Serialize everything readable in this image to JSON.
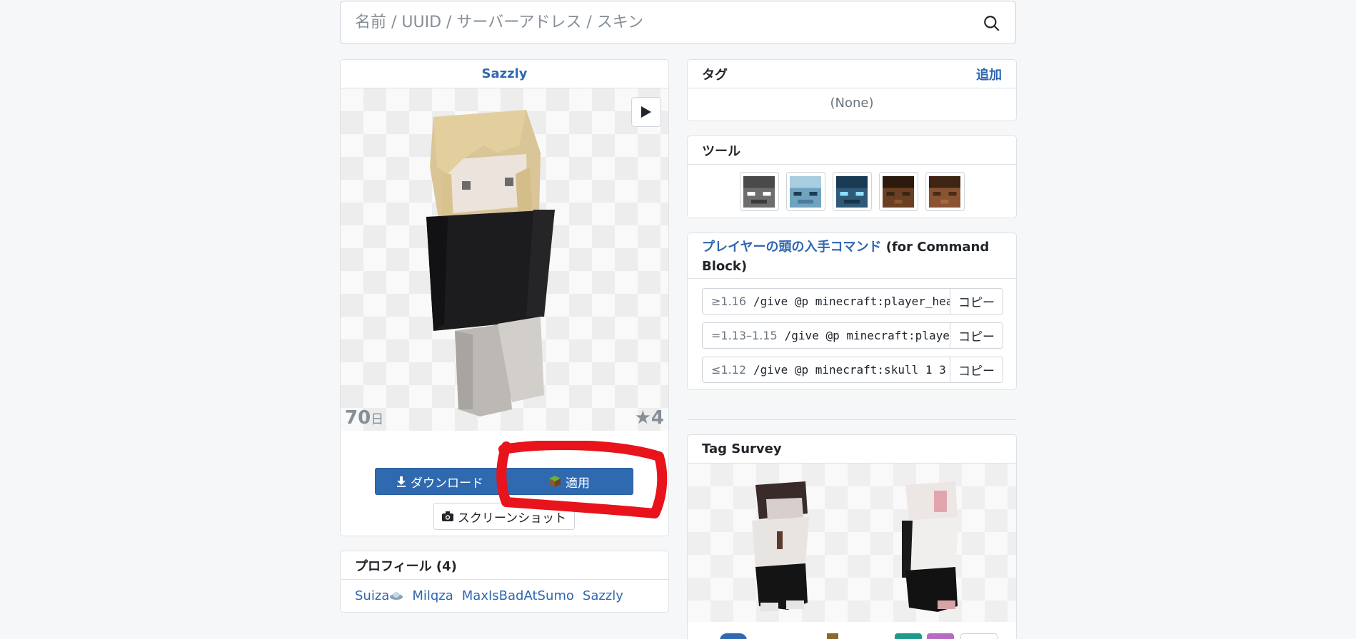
{
  "search": {
    "placeholder": "名前 / UUID / サーバーアドレス / スキン"
  },
  "skin": {
    "name": "Sazzly",
    "days_value": "70",
    "days_unit": "日",
    "stars": "★4",
    "download_label": "ダウンロード",
    "apply_label": "適用",
    "screenshot_label": "スクリーンショット"
  },
  "profile": {
    "title": "プロフィール (4)",
    "names": [
      "Suiza",
      "Milqza",
      "MaxIsBadAtSumo",
      "Sazzly"
    ]
  },
  "tags": {
    "title": "タグ",
    "add_label": "追加",
    "none_text": "(None)"
  },
  "tools": {
    "title": "ツール"
  },
  "command": {
    "title_link": "プレイヤーの頭の入手コマンド",
    "title_rest": " (for Command Block)",
    "rows": [
      {
        "version": "≥1.16",
        "cmd": "/give @p minecraft:player_head",
        "copy": "コピー"
      },
      {
        "version": "=1.13–1.15",
        "cmd": "/give @p minecraft:player_head",
        "copy": "コピー"
      },
      {
        "version": "≤1.12",
        "cmd": "/give @p minecraft:skull 1 3",
        "copy": "コピー"
      }
    ]
  },
  "survey": {
    "title": "Tag Survey"
  },
  "colors": {
    "accent": "#2f6ab1",
    "link": "#2f67b1",
    "annotation": "#e8131b"
  }
}
